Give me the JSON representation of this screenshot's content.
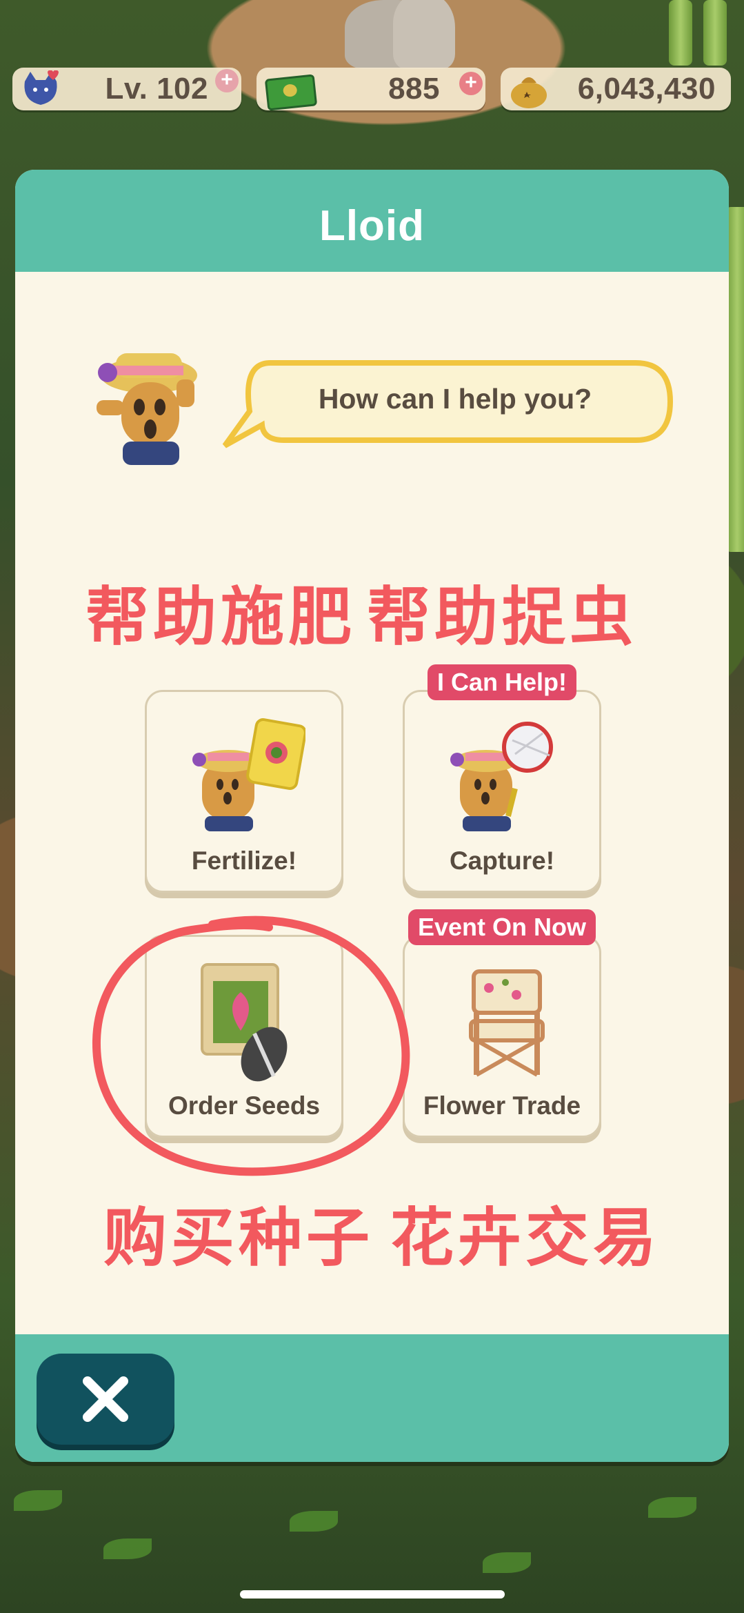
{
  "hud": {
    "level_label": "Lv. 102",
    "tickets": "885",
    "bells": "6,043,430",
    "level_icon": "cat-face-icon",
    "tickets_icon": "leaf-ticket-icon",
    "bells_icon": "bell-bag-icon",
    "add_icon": "plus-icon"
  },
  "dialog": {
    "title": "Lloid",
    "speech": "How can I help you?",
    "npc_icon": "gyroid-avatar",
    "close_icon": "close-icon",
    "options": [
      {
        "label": "Fertilize!",
        "badge": "",
        "icon": "fertilizer-bag-icon"
      },
      {
        "label": "Capture!",
        "badge": "I Can Help!",
        "icon": "bug-net-icon"
      },
      {
        "label": "Order Seeds",
        "badge": "",
        "icon": "seed-packet-icon"
      },
      {
        "label": "Flower Trade",
        "badge": "Event On Now",
        "icon": "flower-chair-icon"
      }
    ]
  },
  "annotations": {
    "top_left": "帮助施肥",
    "top_right": "帮助捉虫",
    "bottom_left": "购买种子",
    "bottom_right": "花卉交易"
  },
  "colors": {
    "header_teal": "#5bbfa8",
    "panel_cream": "#fbf6e7",
    "close_button": "#11525e",
    "badge_red": "#e14a68",
    "annotation_red": "#f2595e"
  }
}
